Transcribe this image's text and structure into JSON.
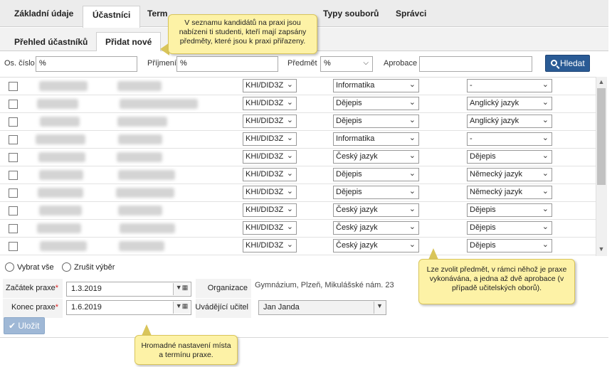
{
  "top_tabs": [
    "Základní údaje",
    "Účastníci",
    "Term",
    "Typy souborů",
    "Správci"
  ],
  "sub_tabs": [
    "Přehled účastníků",
    "Přidat nové"
  ],
  "filter": {
    "os_cislo_label": "Os. číslo",
    "os_cislo_value": "%",
    "prijmeni_label": "Příjmení",
    "prijmeni_value": "%",
    "predmet_label": "Předmět",
    "predmet_value": "%",
    "aprobace_label": "Aprobace",
    "aprobace_value": "",
    "search_label": "Hledat"
  },
  "rows": [
    {
      "course": "KHI/DID3Z",
      "subject": "Informatika",
      "aprobace": "-"
    },
    {
      "course": "KHI/DID3Z",
      "subject": "Dějepis",
      "aprobace": "Anglický jazyk"
    },
    {
      "course": "KHI/DID3Z",
      "subject": "Dějepis",
      "aprobace": "Anglický jazyk"
    },
    {
      "course": "KHI/DID3Z",
      "subject": "Informatika",
      "aprobace": "-"
    },
    {
      "course": "KHI/DID3Z",
      "subject": "Český jazyk",
      "aprobace": "Dějepis"
    },
    {
      "course": "KHI/DID3Z",
      "subject": "Dějepis",
      "aprobace": "Německý jazyk"
    },
    {
      "course": "KHI/DID3Z",
      "subject": "Dějepis",
      "aprobace": "Německý jazyk"
    },
    {
      "course": "KHI/DID3Z",
      "subject": "Český jazyk",
      "aprobace": "Dějepis"
    },
    {
      "course": "KHI/DID3Z",
      "subject": "Český jazyk",
      "aprobace": "Dějepis"
    },
    {
      "course": "KHI/DID3Z",
      "subject": "Český jazyk",
      "aprobace": "Dějepis"
    }
  ],
  "selection": {
    "select_all": "Vybrat vše",
    "deselect": "Zrušit výběr"
  },
  "form": {
    "start_label": "Začátek praxe",
    "start_value": "1.3.2019",
    "end_label": "Konec praxe",
    "end_value": "1.6.2019",
    "org_label": "Organizace",
    "org_value": "Gymnázium, Plzeň, Mikulášské nám. 23",
    "teacher_label": "Uvádějící učitel",
    "teacher_value": "Jan Janda",
    "save_label": "Uložit"
  },
  "callouts": {
    "top": "V seznamu kandidátů na praxi jsou nabízeni ti studenti, kteří mají zapsány předměty, které jsou k praxi přiřazeny.",
    "right": "Lze zvolit předmět, v rámci něhož je praxe vykonávána, a jedna až dvě aprobace (v případě učitelských oborů).",
    "bottom": "Hromadné nastavení místa a termínu praxe."
  },
  "colors": {
    "primary_button": "#2a5b95",
    "callout_bg": "#fdf2a6",
    "required_star": "#dd2222"
  }
}
